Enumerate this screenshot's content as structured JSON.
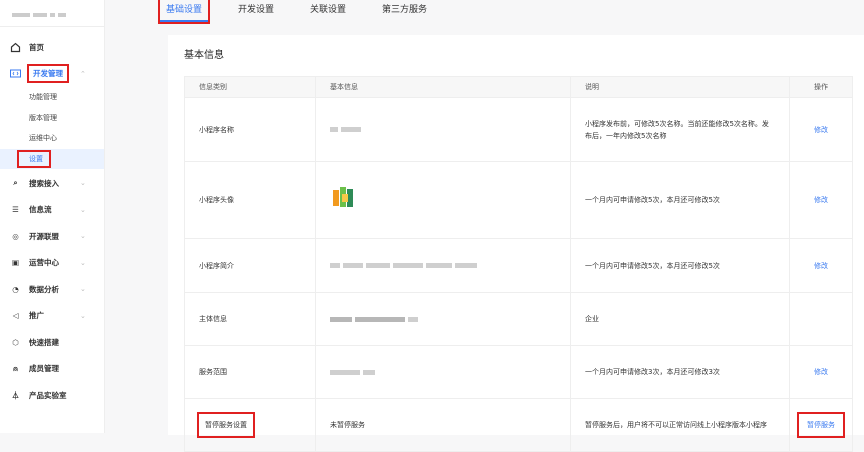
{
  "sidebar": {
    "items": [
      {
        "label": "首页",
        "icon": "home-icon"
      },
      {
        "label": "开发管理",
        "icon": "code-icon",
        "expanded": true,
        "sub": [
          "功能管理",
          "版本管理",
          "运维中心",
          "设置"
        ]
      },
      {
        "label": "搜索接入",
        "icon": "search-icon"
      },
      {
        "label": "信息流",
        "icon": "feed-icon"
      },
      {
        "label": "开源联盟",
        "icon": "alliance-icon"
      },
      {
        "label": "运营中心",
        "icon": "operations-icon"
      },
      {
        "label": "数据分析",
        "icon": "chart-pie-icon"
      },
      {
        "label": "推广",
        "icon": "megaphone-icon"
      },
      {
        "label": "快速搭建",
        "icon": "cube-icon"
      },
      {
        "label": "成员管理",
        "icon": "user-icon"
      },
      {
        "label": "产品实验室",
        "icon": "flask-icon"
      }
    ]
  },
  "tabs": [
    "基础设置",
    "开发设置",
    "关联设置",
    "第三方服务"
  ],
  "section_title": "基本信息",
  "table": {
    "headers": [
      "信息类别",
      "基本信息",
      "说明",
      "操作"
    ],
    "rows": [
      {
        "category": "小程序名称",
        "info": "",
        "desc": "小程序发布前，可修改5次名称。当前还能修改5次名称。发布后，一年内修改5次名称",
        "action": "修改"
      },
      {
        "category": "小程序头像",
        "info": "",
        "desc": "一个月内可申请修改5次，本月还可修改5次",
        "action": "修改"
      },
      {
        "category": "小程序简介",
        "info": "",
        "desc": "一个月内可申请修改5次，本月还可修改5次",
        "action": "修改"
      },
      {
        "category": "主体信息",
        "info": "",
        "desc": "企业",
        "action": ""
      },
      {
        "category": "服务范围",
        "info": "",
        "desc": "一个月内可申请修改3次，本月还可修改3次",
        "action": "修改"
      },
      {
        "category": "暂停服务设置",
        "info": "未暂停服务",
        "desc": "暂停服务后，用户将不可以正常访问线上小程序版本小程序",
        "action": "暂停服务"
      }
    ]
  },
  "colors": {
    "accent": "#3a7af0",
    "highlight": "#e02020"
  }
}
